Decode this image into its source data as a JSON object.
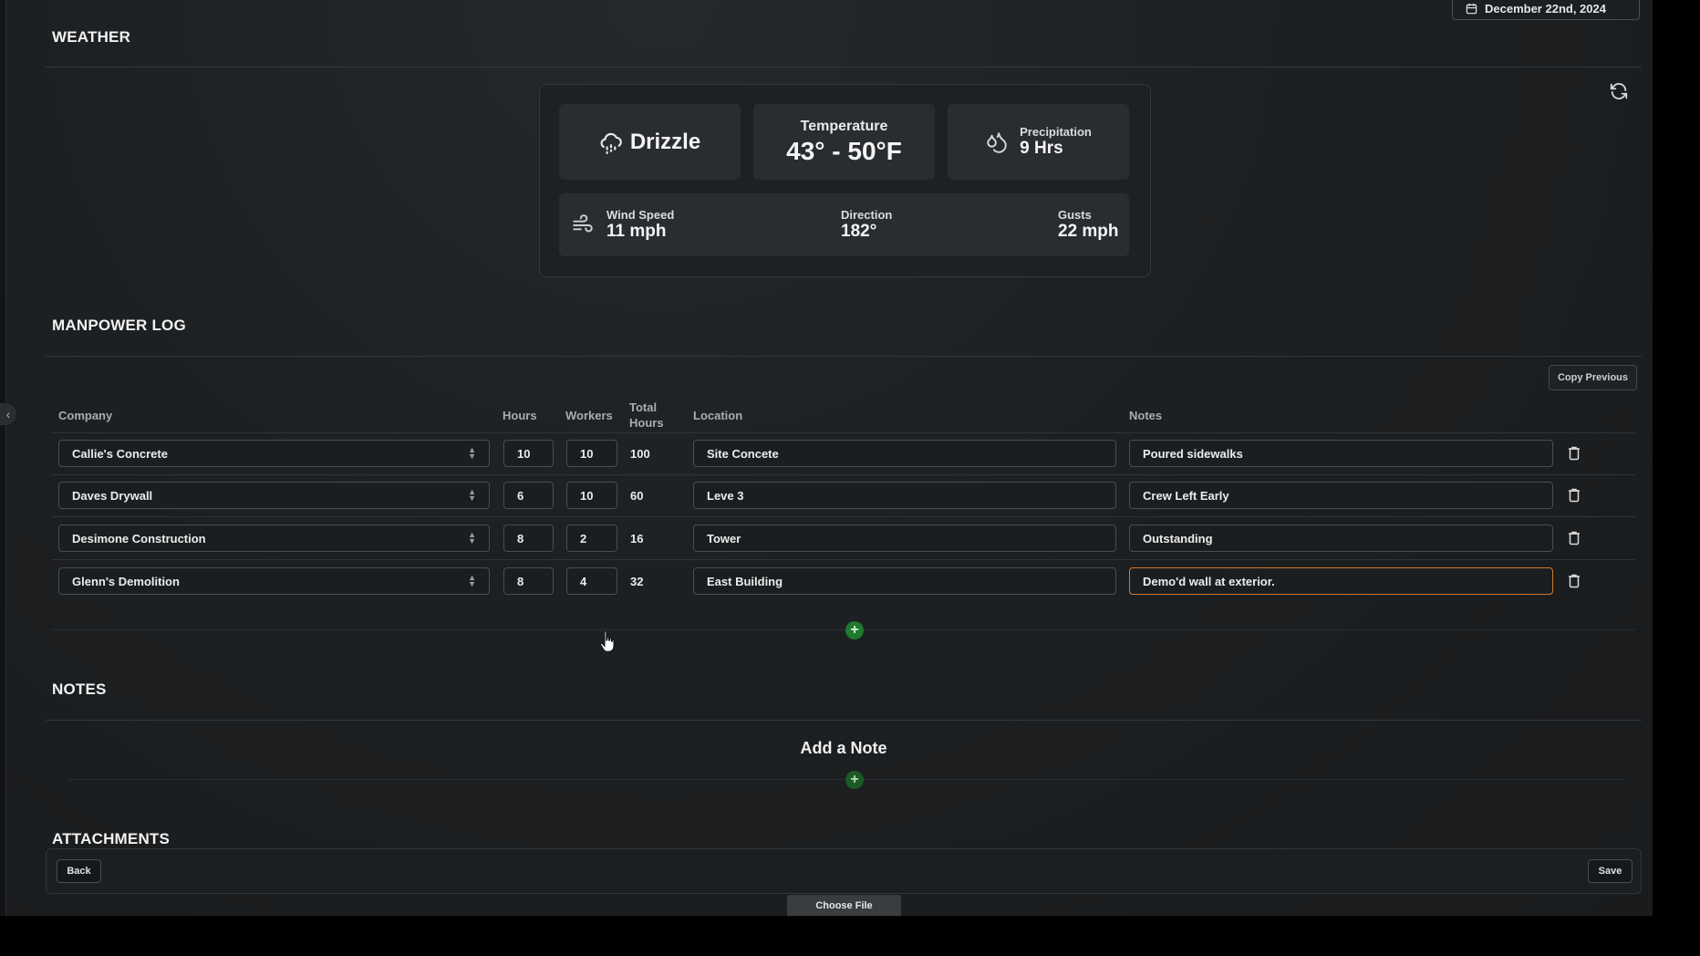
{
  "header": {
    "date": "December 22nd, 2024"
  },
  "weather": {
    "title": "WEATHER",
    "condition": "Drizzle",
    "temperature_label": "Temperature",
    "temperature_value": "43° - 50°F",
    "precipitation_label": "Precipitation",
    "precipitation_value": "9 Hrs",
    "wind_speed_label": "Wind Speed",
    "wind_speed_value": "11 mph",
    "direction_label": "Direction",
    "direction_value": "182°",
    "gusts_label": "Gusts",
    "gusts_value": "22 mph"
  },
  "manpower": {
    "title": "MANPOWER LOG",
    "copy_previous_label": "Copy Previous",
    "columns": {
      "company": "Company",
      "hours": "Hours",
      "workers": "Workers",
      "total_hours": "Total Hours",
      "location": "Location",
      "notes": "Notes"
    },
    "rows": [
      {
        "company": "Callie's Concrete",
        "hours": "10",
        "workers": "10",
        "total": "100",
        "location": "Site Concete",
        "notes": "Poured sidewalks"
      },
      {
        "company": "Daves Drywall",
        "hours": "6",
        "workers": "10",
        "total": "60",
        "location": "Leve 3",
        "notes": "Crew Left Early"
      },
      {
        "company": "Desimone Construction",
        "hours": "8",
        "workers": "2",
        "total": "16",
        "location": "Tower",
        "notes": "Outstanding"
      },
      {
        "company": "Glenn's Demolition",
        "hours": "8",
        "workers": "4",
        "total": "32",
        "location": "East Building",
        "notes": "Demo'd wall at exterior."
      }
    ]
  },
  "notes": {
    "title": "NOTES",
    "add_note_label": "Add a Note"
  },
  "attachments": {
    "title": "ATTACHMENTS",
    "back_label": "Back",
    "save_label": "Save",
    "choose_file_label": "Choose File"
  },
  "icons": {
    "calendar": "calendar-icon",
    "refresh": "refresh-icon",
    "drizzle": "cloud-drizzle-icon",
    "precipitation": "droplets-icon",
    "wind": "wind-icon",
    "trash": "trash-icon",
    "add": "plus-circle-icon",
    "collapse": "chevron-left-icon"
  },
  "colors": {
    "background": "#1d2022",
    "tile": "#2a2d30",
    "active_border": "#d4782c",
    "add_button": "#1f7a2e"
  }
}
